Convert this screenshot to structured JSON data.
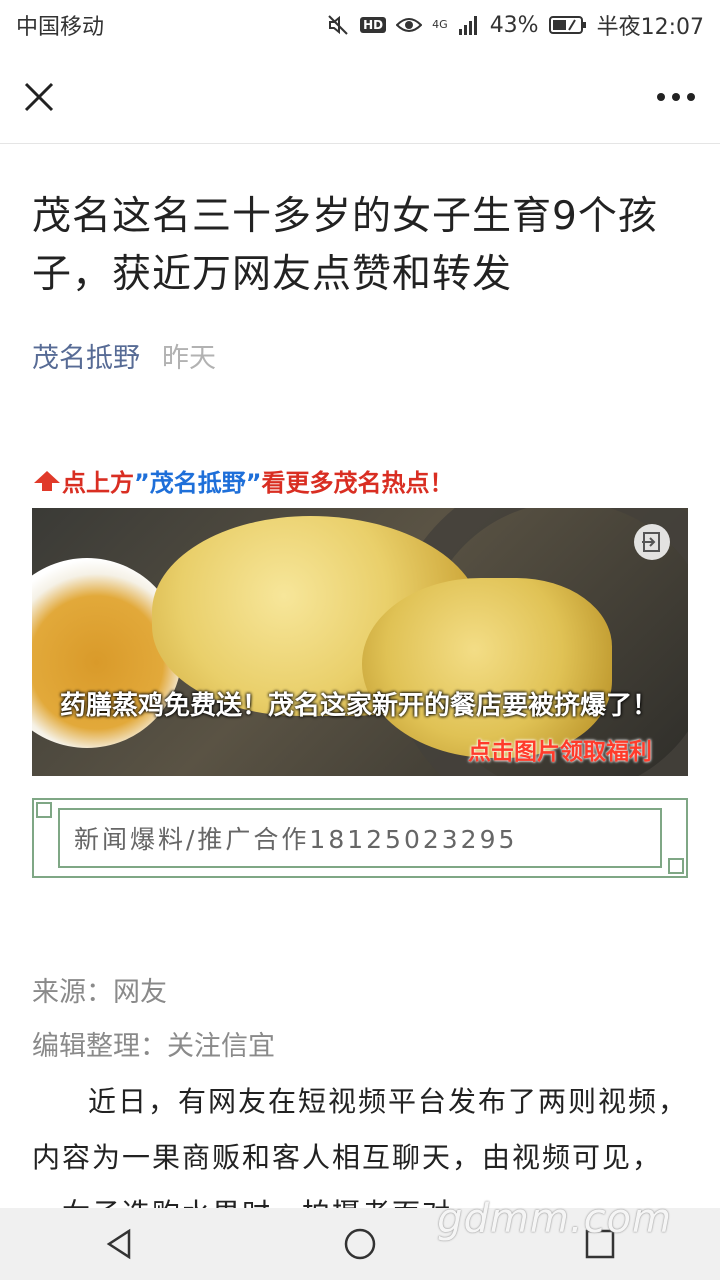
{
  "status_bar": {
    "carrier": "中国移动",
    "hd_badge": "HD",
    "network_type": "4G",
    "battery": "43%",
    "time": "半夜12:07"
  },
  "top_bar": {
    "close_icon": "close-icon",
    "more_icon": "more-icon"
  },
  "article": {
    "title": "茂名这名三十多岁的女子生育9个孩子，获近万网友点赞和转发",
    "author": "茂名抵野",
    "date": "昨天",
    "promo": {
      "prefix": "点上方",
      "highlight": "”茂名抵野”",
      "suffix": "看更多茂名热点！"
    },
    "banner": {
      "caption": "药膳蒸鸡免费送！茂名这家新开的餐店要被挤爆了！",
      "cta": "点击图片领取福利"
    },
    "hotline": "新闻爆料/推广合作18125023295",
    "source": "来源：网友",
    "editor": "编辑整理：关注信宜",
    "paragraph": "近日，有网友在短视频平台发布了两则视频，内容为一果商贩和客人相互聊天，由视频可见，一女子选购水果时，拍摄者面对"
  },
  "watermark": "gdmm.com",
  "colors": {
    "author_blue": "#576b95",
    "promo_red": "#d92e22",
    "promo_highlight": "#1e6fd9",
    "frame_green": "#7fa785"
  }
}
